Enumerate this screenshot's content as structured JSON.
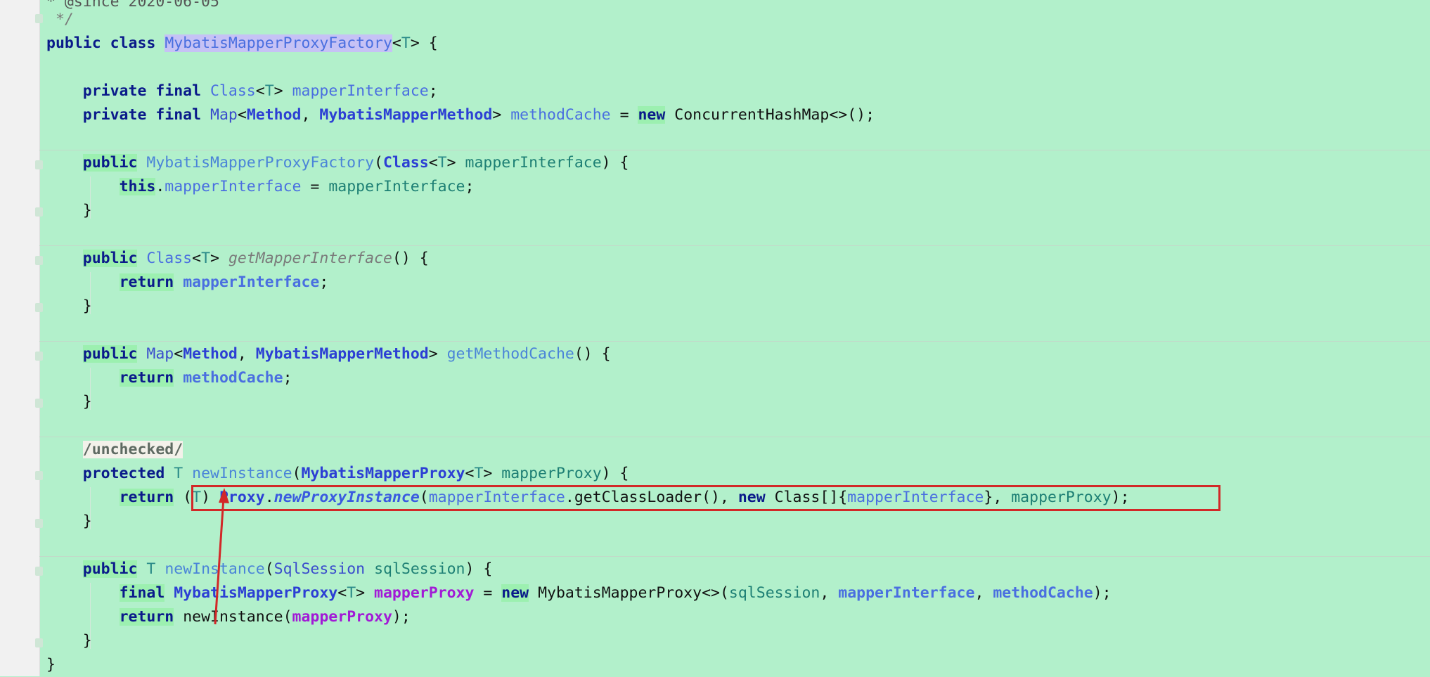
{
  "editor": {
    "line0": "* @since 2020-06-05",
    "line1": "*/",
    "kw_public": "public",
    "kw_class": "class",
    "kw_private": "private",
    "kw_final": "final",
    "kw_new": "new",
    "kw_this": "this",
    "kw_return": "return",
    "kw_protected": "protected",
    "t_param": "T",
    "class_name": "MybatisMapperProxyFactory",
    "type_class": "Class",
    "type_map": "Map",
    "type_method": "Method",
    "type_mmm": "MybatisMapperMethod",
    "type_chm": "ConcurrentHashMap",
    "type_mmp": "MybatisMapperProxy",
    "type_proxy": "Proxy",
    "type_sqlsession": "SqlSession",
    "f_mapperInterface": "mapperInterface",
    "f_methodCache": "methodCache",
    "m_getMapperInterface": "getMapperInterface",
    "m_getMethodCache": "getMethodCache",
    "m_newInstance": "newInstance",
    "m_newProxyInstance": "newProxyInstance",
    "m_getClassLoader": "getClassLoader",
    "p_mapperProxy": "mapperProxy",
    "p_sqlSession": "sqlSession",
    "annotation": "/unchecked/"
  },
  "colors": {
    "editor_bg": "#b2f0cb",
    "highlight_box": "#d22828",
    "arrow": "#d22828"
  }
}
